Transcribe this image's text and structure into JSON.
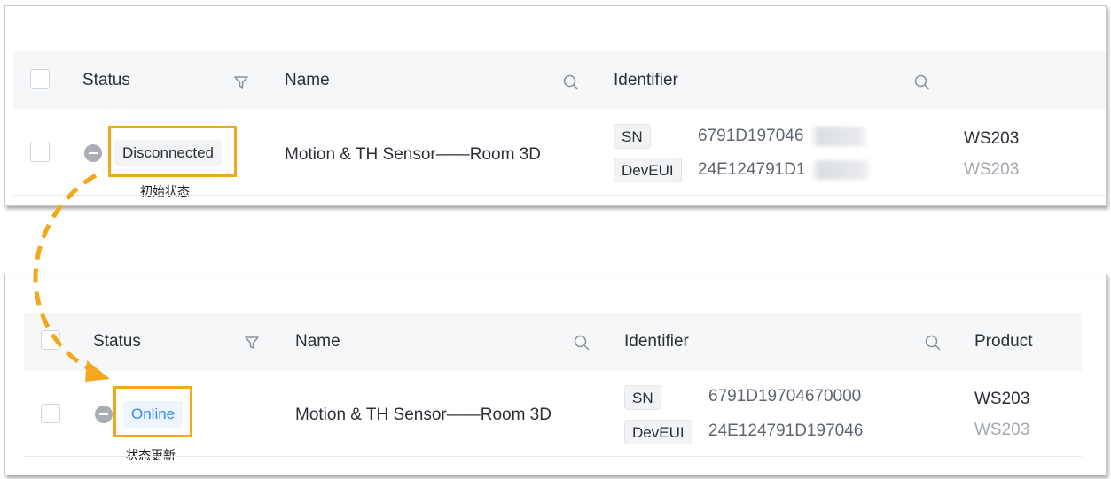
{
  "table_header": {
    "status": "Status",
    "name": "Name",
    "identifier": "Identifier",
    "product": "Product"
  },
  "top_panel": {
    "row": {
      "status": "Disconnected",
      "name": "Motion & TH Sensor——Room 3D",
      "sn_tag": "SN",
      "sn_value": "6791D197046",
      "deveui_tag": "DevEUI",
      "deveui_value": "24E124791D1",
      "product": "WS203",
      "product_sub": "WS203"
    },
    "caption": "初始状态"
  },
  "bottom_panel": {
    "row": {
      "status": "Online",
      "name": "Motion & TH Sensor——Room 3D",
      "sn_tag": "SN",
      "sn_value": "6791D19704670000",
      "deveui_tag": "DevEUI",
      "deveui_value": "24E124791D197046",
      "product": "WS203",
      "product_sub": "WS203"
    },
    "caption": "状态更新"
  },
  "colors": {
    "highlight": "#f2a81d",
    "online_text": "#2e8bf0",
    "online_bg": "#eef5fe",
    "disconnected_dot": "#a9adb4",
    "header_bg": "#f6f7f9"
  },
  "icons": {
    "filter": "filter-icon",
    "search": "search-icon",
    "status_indicator": "minus-circle-icon",
    "flow": "dashed-curved-arrow"
  }
}
